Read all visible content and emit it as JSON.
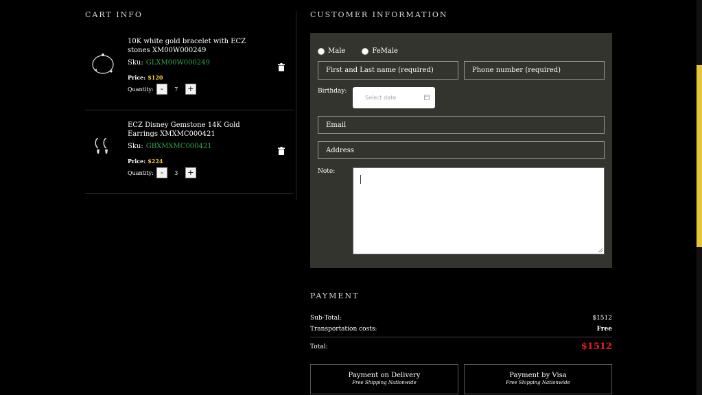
{
  "cart": {
    "title": "CART INFO",
    "items": [
      {
        "name": "10K white gold bracelet with ECZ stones XM00W000249",
        "sku_label": "Sku:",
        "sku": "GLXM00W000249",
        "price_label": "Price:",
        "price": "$120",
        "qty_label": "Quantity:",
        "qty": "7",
        "minus": "-",
        "plus": "+"
      },
      {
        "name": "ECZ Disney Gemstone 14K Gold Earrings XMXMC000421",
        "sku_label": "Sku:",
        "sku": "GBXMXMC000421",
        "price_label": "Price:",
        "price": "$224",
        "qty_label": "Quantity:",
        "qty": "3",
        "minus": "-",
        "plus": "+"
      }
    ]
  },
  "customer": {
    "title": "CUSTOMER INFORMATION",
    "gender_options": [
      "Male",
      "FeMale"
    ],
    "name_placeholder": "First and Last name (required)",
    "phone_placeholder": "Phone number (required)",
    "birthday_label": "Birthday:",
    "date_placeholder": "Select date",
    "email_placeholder": "Email",
    "address_placeholder": "Address",
    "note_label": "Note:"
  },
  "payment": {
    "title": "PAYMENT",
    "subtotal_label": "Sub-Total:",
    "subtotal": "$1512",
    "shipping_label": "Transportation costs:",
    "shipping": "Free",
    "total_label": "Total:",
    "total": "$1512",
    "options": [
      {
        "label": "Payment on Delivery",
        "sub": "Free Shipping Nationwide"
      },
      {
        "label": "Payment by Visa",
        "sub": "Free Shipping Nationwide"
      }
    ]
  },
  "colors": {
    "background": "#000000",
    "form_panel": "#34342f",
    "sku": "#29a84a",
    "price": "#f2d13b",
    "total": "#e8202a",
    "scrollbar_thumb": "#e6c43a"
  }
}
